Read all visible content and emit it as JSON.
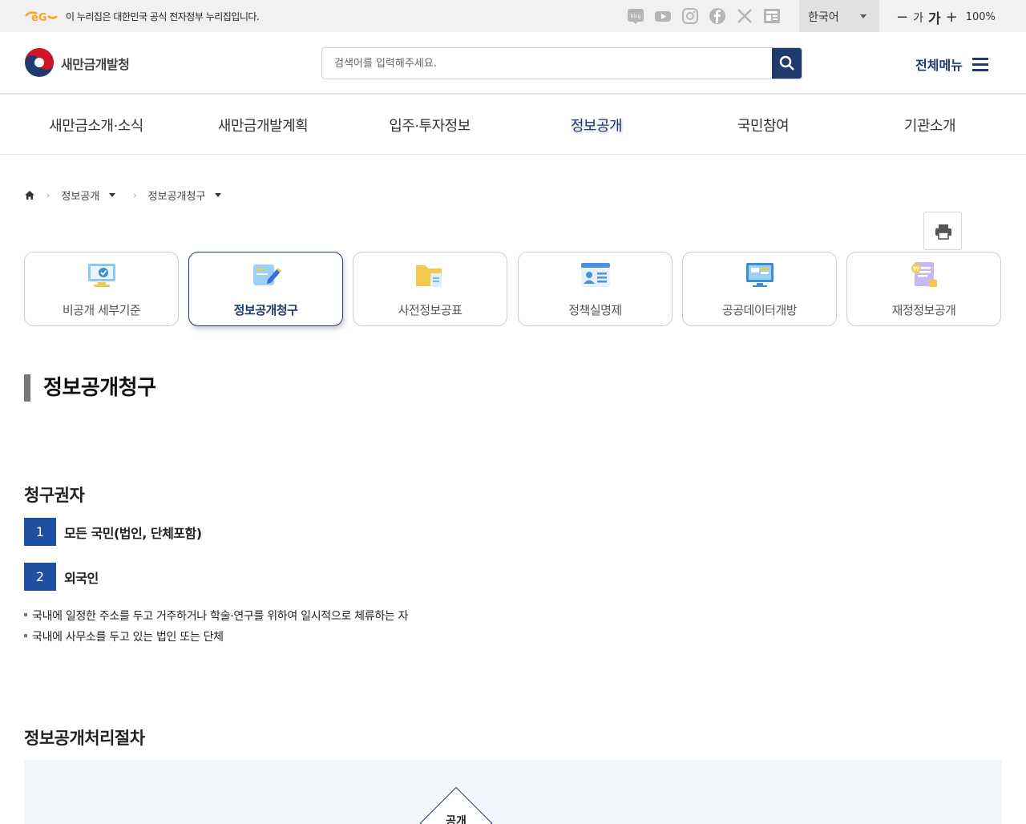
{
  "govbar": {
    "text": "이 누리집은 대한민국 공식 전자정부 누리집입니다.",
    "sns": [
      "blog-icon",
      "youtube-icon",
      "instagram-icon",
      "facebook-icon",
      "x-icon",
      "news-icon"
    ],
    "language": "한국어",
    "font_small": "가",
    "font_large": "가",
    "zoom": "100%"
  },
  "header": {
    "site_name": "새만금개발청",
    "search_placeholder": "검색어를 입력해주세요.",
    "all_menu": "전체메뉴"
  },
  "gnb": [
    {
      "label": "새만금소개·소식",
      "active": false
    },
    {
      "label": "새만금개발계획",
      "active": false
    },
    {
      "label": "입주·투자정보",
      "active": false
    },
    {
      "label": "정보공개",
      "active": true
    },
    {
      "label": "국민참여",
      "active": false
    },
    {
      "label": "기관소개",
      "active": false
    }
  ],
  "breadcrumb": [
    "정보공개",
    "정보공개청구"
  ],
  "quick_tabs": [
    {
      "label": "비공개 세부기준",
      "icon": "monitor-check-icon",
      "active": false
    },
    {
      "label": "정보공개청구",
      "icon": "document-pen-icon",
      "active": true
    },
    {
      "label": "사전정보공표",
      "icon": "folder-icon",
      "active": false
    },
    {
      "label": "정책실명제",
      "icon": "id-card-icon",
      "active": false
    },
    {
      "label": "공공데이터개방",
      "icon": "data-monitor-icon",
      "active": false
    },
    {
      "label": "재정정보공개",
      "icon": "finance-document-icon",
      "active": false
    }
  ],
  "page_title": "정보공개청구",
  "section1": {
    "title": "청구권자",
    "items": [
      {
        "num": "1",
        "text": "모든 국민(법인, 단체포함)"
      },
      {
        "num": "2",
        "text": "외국인"
      }
    ],
    "bullets": [
      "국내에 일정한 주소를 두고 거주하거나 학술·연구를 위하여 일시적으로 체류하는 자",
      "국내에 사무소를 두고 있는 법인 또는 단체"
    ]
  },
  "section2": {
    "title": "정보공개처리절차",
    "diagram_first": "공개"
  },
  "colors": {
    "primary": "#1f3a6d",
    "number_box": "#1f4fa0",
    "govbar_bg": "#f1f1f1"
  }
}
